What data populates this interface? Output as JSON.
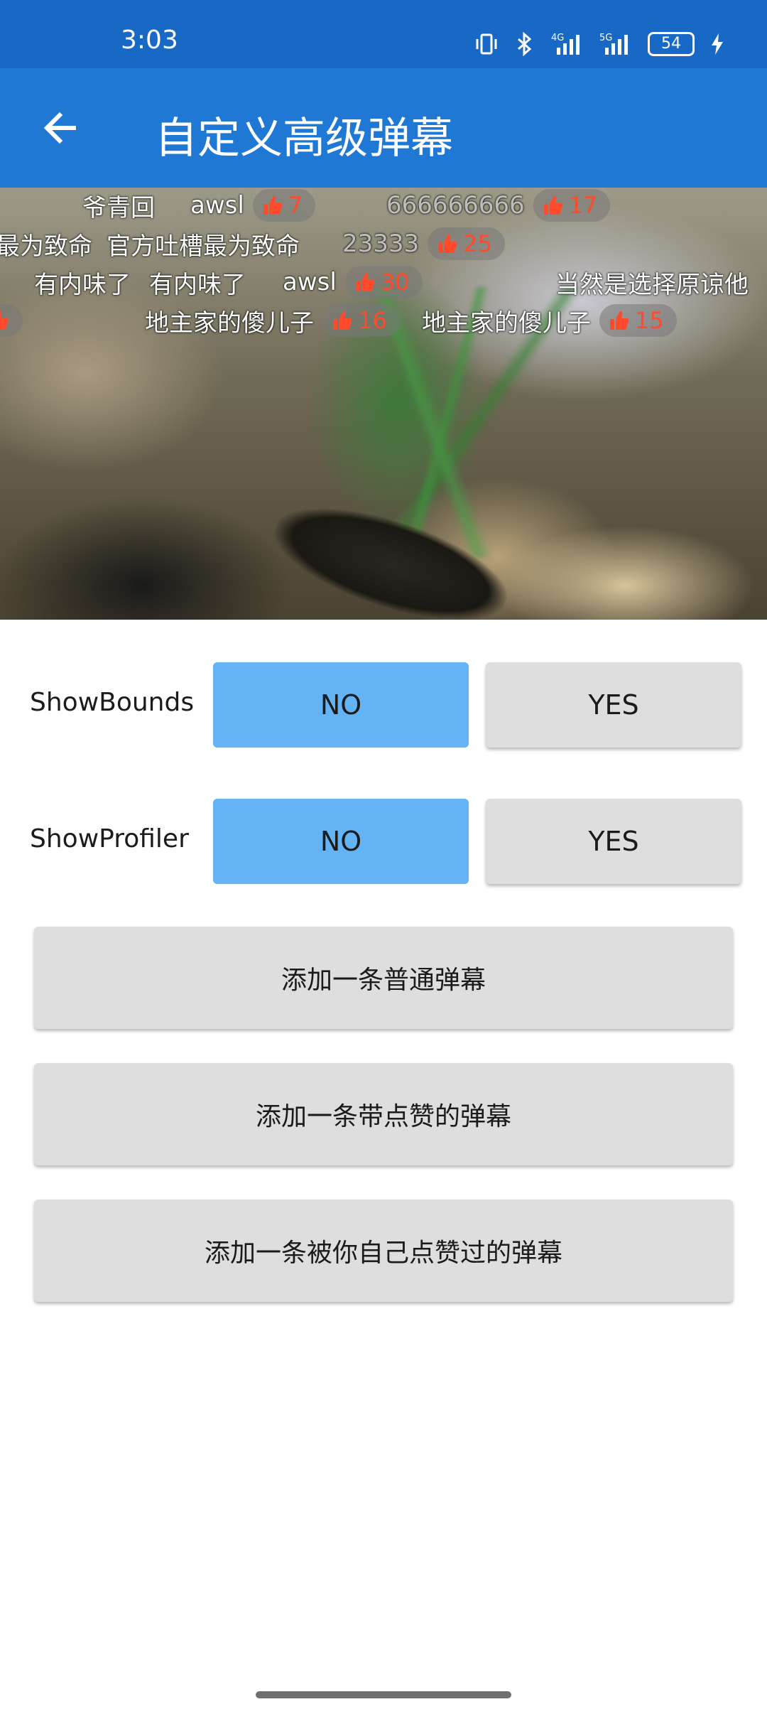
{
  "status_bar": {
    "time": "3:03",
    "battery": "54",
    "network_1": "4G",
    "network_2": "5G"
  },
  "app_bar": {
    "title": "自定义高级弹幕",
    "back_icon": "arrow-back-icon"
  },
  "danmaku": {
    "rows": [
      {
        "items": [
          {
            "text": "爷青回"
          },
          {
            "text": "awsl",
            "likes": "7"
          },
          {
            "text": "666666666",
            "likes": "17"
          }
        ]
      },
      {
        "items": [
          {
            "text": "最为致命"
          },
          {
            "text": "官方吐槽最为致命"
          },
          {
            "text": "23333",
            "likes": "25"
          }
        ]
      },
      {
        "items": [
          {
            "text": "有内味了"
          },
          {
            "text": "有内味了"
          },
          {
            "text": "awsl",
            "likes": "30"
          },
          {
            "text": "当然是选择原谅他"
          }
        ]
      },
      {
        "items": [
          {
            "text": "地主家的傻儿子",
            "likes": "16"
          },
          {
            "text": "地主家的傻儿子",
            "likes": "15"
          }
        ]
      }
    ],
    "like_color": "#ff4a2c"
  },
  "controls": {
    "show_bounds": {
      "label": "ShowBounds",
      "no": "NO",
      "yes": "YES",
      "selected": "NO"
    },
    "show_profiler": {
      "label": "ShowProfiler",
      "no": "NO",
      "yes": "YES",
      "selected": "NO"
    },
    "add_normal": "添加一条普通弹幕",
    "add_liked": "添加一条带点赞的弹幕",
    "add_self_liked": "添加一条被你自己点赞过的弹幕"
  },
  "colors": {
    "status_bar": "#1869c6",
    "app_bar": "#1e78d4",
    "selected_button": "#63b3f5",
    "default_button": "#dedede"
  }
}
